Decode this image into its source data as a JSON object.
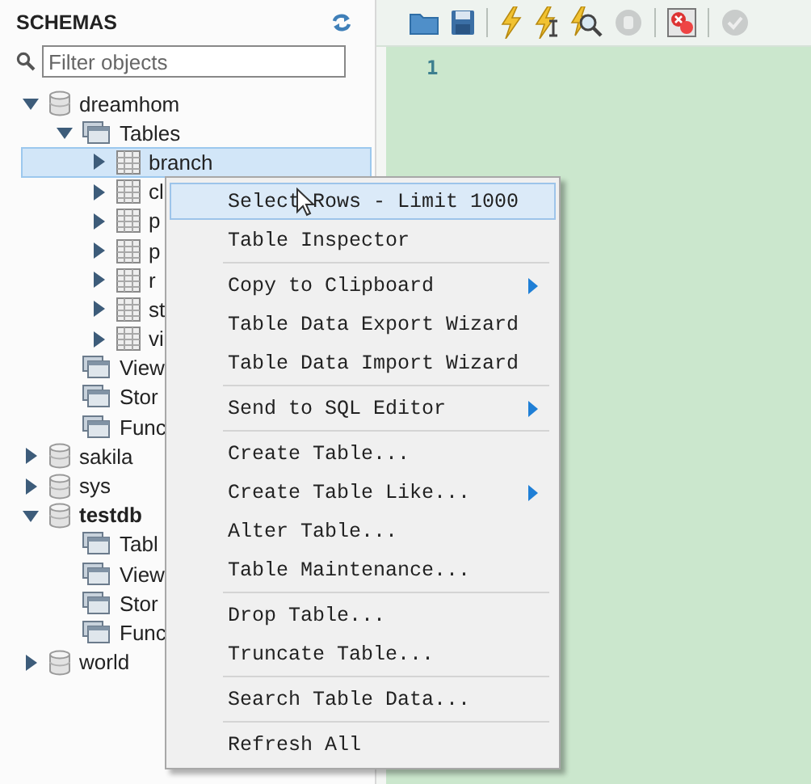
{
  "sidebar": {
    "title": "SCHEMAS",
    "filter": {
      "placeholder": "Filter objects"
    },
    "tree": [
      {
        "label": "dreamhom",
        "kind": "schema",
        "expanded": true,
        "default": false,
        "selected": false,
        "children": [
          {
            "label": "Tables",
            "kind": "folder",
            "expanded": true,
            "selected": false,
            "children": [
              {
                "label": "branch",
                "kind": "table",
                "expanded": false,
                "selected": true
              },
              {
                "label": "cl",
                "kind": "table",
                "expanded": false,
                "selected": false
              },
              {
                "label": "p",
                "kind": "table",
                "expanded": false,
                "selected": false
              },
              {
                "label": "p",
                "kind": "table",
                "expanded": false,
                "selected": false
              },
              {
                "label": "r",
                "kind": "table",
                "expanded": false,
                "selected": false
              },
              {
                "label": "st",
                "kind": "table",
                "expanded": false,
                "selected": false
              },
              {
                "label": "vi",
                "kind": "table",
                "expanded": false,
                "selected": false
              }
            ]
          },
          {
            "label": "View",
            "kind": "folder",
            "selected": false
          },
          {
            "label": "Stor",
            "kind": "folder",
            "selected": false
          },
          {
            "label": "Func",
            "kind": "folder",
            "selected": false
          }
        ]
      },
      {
        "label": "sakila",
        "kind": "schema",
        "expanded": false,
        "default": false,
        "selected": false
      },
      {
        "label": "sys",
        "kind": "schema",
        "expanded": false,
        "default": false,
        "selected": false
      },
      {
        "label": "testdb",
        "kind": "schema",
        "expanded": true,
        "default": true,
        "selected": false,
        "children": [
          {
            "label": "Tabl",
            "kind": "folder",
            "selected": false
          },
          {
            "label": "View",
            "kind": "folder",
            "selected": false
          },
          {
            "label": "Stor",
            "kind": "folder",
            "selected": false
          },
          {
            "label": "Func",
            "kind": "folder",
            "selected": false
          }
        ]
      },
      {
        "label": "world",
        "kind": "schema",
        "expanded": false,
        "default": false,
        "selected": false
      }
    ]
  },
  "editor": {
    "line_numbers": [
      "1"
    ]
  },
  "context_menu": {
    "groups": [
      [
        {
          "label": "Select Rows - Limit 1000",
          "submenu": false,
          "selected": true
        },
        {
          "label": "Table Inspector",
          "submenu": false,
          "selected": false
        }
      ],
      [
        {
          "label": "Copy to Clipboard",
          "submenu": true,
          "selected": false
        },
        {
          "label": "Table Data Export Wizard",
          "submenu": false,
          "selected": false
        },
        {
          "label": "Table Data Import Wizard",
          "submenu": false,
          "selected": false
        }
      ],
      [
        {
          "label": "Send to SQL Editor",
          "submenu": true,
          "selected": false
        }
      ],
      [
        {
          "label": "Create Table...",
          "submenu": false,
          "selected": false
        },
        {
          "label": "Create Table Like...",
          "submenu": true,
          "selected": false
        },
        {
          "label": "Alter Table...",
          "submenu": false,
          "selected": false
        },
        {
          "label": "Table Maintenance...",
          "submenu": false,
          "selected": false
        }
      ],
      [
        {
          "label": "Drop Table...",
          "submenu": false,
          "selected": false
        },
        {
          "label": "Truncate Table...",
          "submenu": false,
          "selected": false
        }
      ],
      [
        {
          "label": "Search Table Data...",
          "submenu": false,
          "selected": false
        }
      ],
      [
        {
          "label": "Refresh All",
          "submenu": false,
          "selected": false
        }
      ]
    ]
  }
}
